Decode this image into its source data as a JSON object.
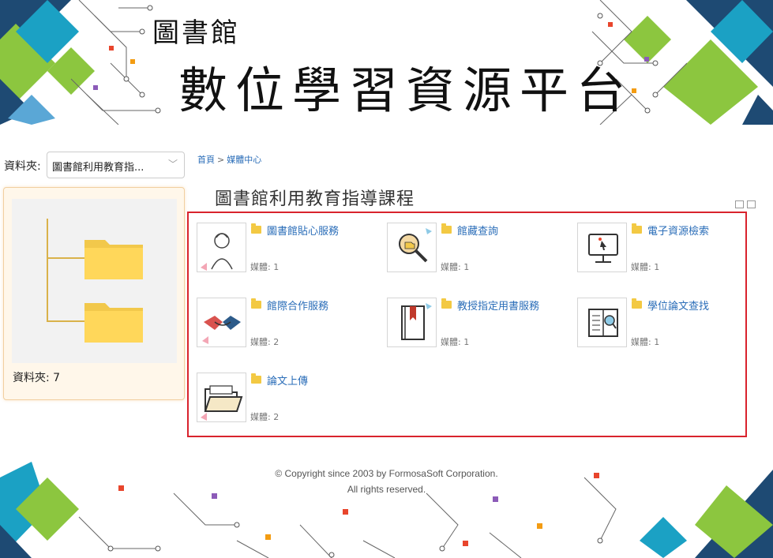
{
  "banner": {
    "small_title": "圖書館",
    "big_title": "數位學習資源平台"
  },
  "sidebar": {
    "folder_label": "資料夾:",
    "folder_select_value": "圖書館利用教育指...",
    "folder_count": "資料夾: 7"
  },
  "breadcrumb": {
    "home": "首頁",
    "separator": ">",
    "current": "媒體中心"
  },
  "main": {
    "title": "圖書館利用教育指導課程",
    "items": [
      {
        "title": "圖書館貼心服務",
        "meta": "媒體: 1",
        "icon": "librarian-icon"
      },
      {
        "title": "館藏查詢",
        "meta": "媒體: 1",
        "icon": "magnifier-icon"
      },
      {
        "title": "電子資源檢索",
        "meta": "媒體: 1",
        "icon": "monitor-icon"
      },
      {
        "title": "館際合作服務",
        "meta": "媒體: 2",
        "icon": "handshake-icon"
      },
      {
        "title": "教授指定用書服務",
        "meta": "媒體: 1",
        "icon": "book-icon"
      },
      {
        "title": "學位論文查找",
        "meta": "媒體: 1",
        "icon": "thesis-search-icon"
      },
      {
        "title": "論文上傳",
        "meta": "媒體: 2",
        "icon": "folder-upload-icon"
      }
    ]
  },
  "footer": {
    "copyright": "© Copyright since 2003 by FormosaSoft Corporation.",
    "rights": "All rights reserved."
  },
  "colors": {
    "link": "#2a6db8",
    "highlight_border": "#d9232d",
    "green": "#8cc63f",
    "navy": "#1e4a73",
    "teal": "#1ba1c4"
  }
}
